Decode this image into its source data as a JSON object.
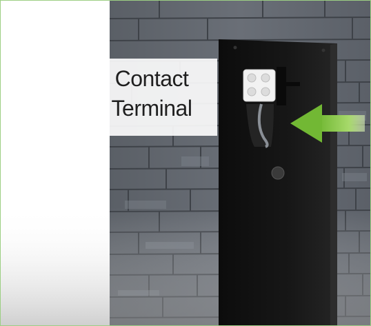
{
  "callout": {
    "line1": "Contact",
    "line2": "Terminal"
  },
  "colors": {
    "border": "#9ccf83",
    "arrow": "#7cc242",
    "panel": "#141414",
    "wall": "#5b6068"
  },
  "icons": [
    "arrow-left-icon"
  ]
}
